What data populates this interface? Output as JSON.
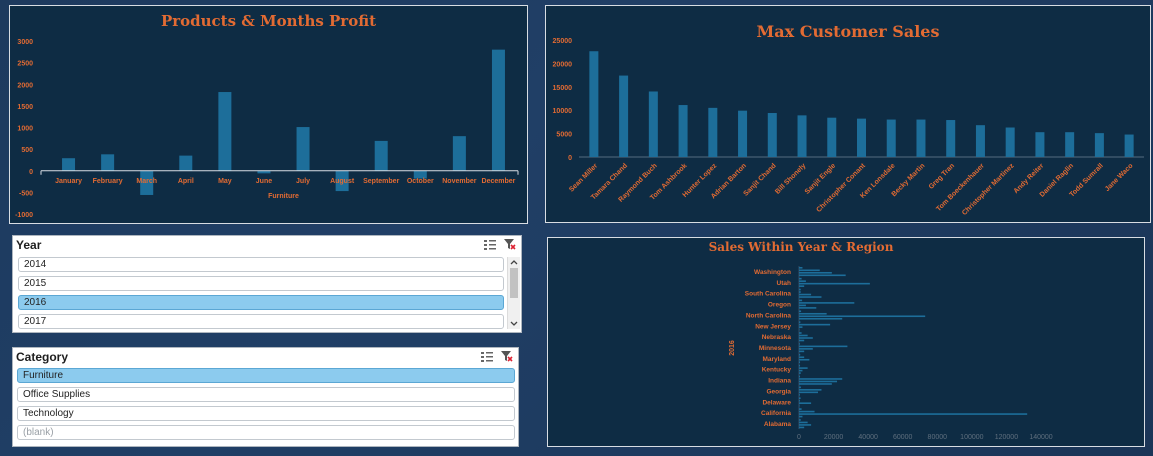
{
  "colors": {
    "bar": "#1d6e9a",
    "text": "#e26b33",
    "panel": "#0e2c44",
    "selected": "#8ccbee"
  },
  "chart_data": [
    {
      "type": "bar",
      "title": "Products & Months Profit",
      "xlabel": "Furniture",
      "categories": [
        "January",
        "February",
        "March",
        "April",
        "May",
        "June",
        "July",
        "August",
        "September",
        "October",
        "November",
        "December"
      ],
      "values": [
        290,
        380,
        -560,
        350,
        1820,
        -60,
        1010,
        -470,
        690,
        -180,
        800,
        2800
      ],
      "ylim": [
        -1000,
        3000
      ],
      "yticks": [
        "3000",
        "2500",
        "2000",
        "1500",
        "1000",
        "500",
        "0",
        "-500",
        "-1000"
      ],
      "ytick_values": [
        3000,
        2500,
        2000,
        1500,
        1000,
        500,
        0,
        -500,
        -1000
      ]
    },
    {
      "type": "bar",
      "title": "Max Customer Sales",
      "categories": [
        "Sean Miller",
        "Tamara Chand",
        "Raymond Buch",
        "Tom Ashbrook",
        "Hunter Lopez",
        "Adrian Barton",
        "Sanjit Chand",
        "Bill Shonely",
        "Sanjit Engle",
        "Christopher Conant",
        "Ken Lonsdale",
        "Becky Martin",
        "Greg Tran",
        "Tom Boeckenhauer",
        "Christopher Martinez",
        "Andy Reiter",
        "Daniel Raglin",
        "Todd Sumrall",
        "Jane Waco"
      ],
      "values": [
        22600,
        17400,
        14000,
        11100,
        10500,
        9900,
        9400,
        8900,
        8400,
        8200,
        8000,
        8000,
        7900,
        6800,
        6300,
        5300,
        5300,
        5100,
        4800
      ],
      "ylim": [
        0,
        25000
      ],
      "yticks": [
        "25000",
        "20000",
        "15000",
        "10000",
        "5000",
        "0"
      ],
      "ytick_values": [
        25000,
        20000,
        15000,
        10000,
        5000,
        0
      ]
    },
    {
      "type": "bar",
      "orientation": "horizontal",
      "title": "Sales Within Year & Region",
      "ylabel": "2016",
      "categories": [
        "Washington",
        "Utah",
        "South Carolina",
        "Oregon",
        "North Carolina",
        "New Jersey",
        "Nebraska",
        "Minnesota",
        "Maryland",
        "Kentucky",
        "Indiana",
        "Georgia",
        "Delaware",
        "California",
        "Alabama"
      ],
      "series": [
        {
          "values": [
            2000,
            1500,
            1000,
            1800,
            1200,
            800,
            1500,
            500,
            700,
            600,
            600,
            1100,
            900,
            1500,
            1000
          ]
        },
        {
          "values": [
            12000,
            4000,
            1000,
            32000,
            16000,
            18000,
            5000,
            28000,
            3000,
            5000,
            25000,
            13000,
            500,
            9000,
            5000
          ]
        },
        {
          "values": [
            19000,
            41000,
            7000,
            4000,
            73000,
            2000,
            8000,
            8000,
            6000,
            2000,
            22000,
            11000,
            7000,
            132000,
            7000
          ]
        },
        {
          "values": [
            27000,
            3000,
            13000,
            10000,
            25000,
            300,
            3000,
            3000,
            600,
            1000,
            19000,
            500,
            200,
            2000,
            3000
          ]
        }
      ],
      "xlim": [
        0,
        140000
      ],
      "xticks": [
        "0",
        "20000",
        "40000",
        "60000",
        "80000",
        "100000",
        "120000",
        "140000"
      ],
      "xtick_values": [
        0,
        20000,
        40000,
        60000,
        80000,
        100000,
        120000,
        140000
      ]
    }
  ],
  "slicers": {
    "year": {
      "title": "Year",
      "items": [
        "2014",
        "2015",
        "2016",
        "2017"
      ],
      "selected": "2016"
    },
    "category": {
      "title": "Category",
      "items": [
        "Furniture",
        "Office Supplies",
        "Technology",
        "(blank)"
      ],
      "selected": "Furniture"
    }
  }
}
